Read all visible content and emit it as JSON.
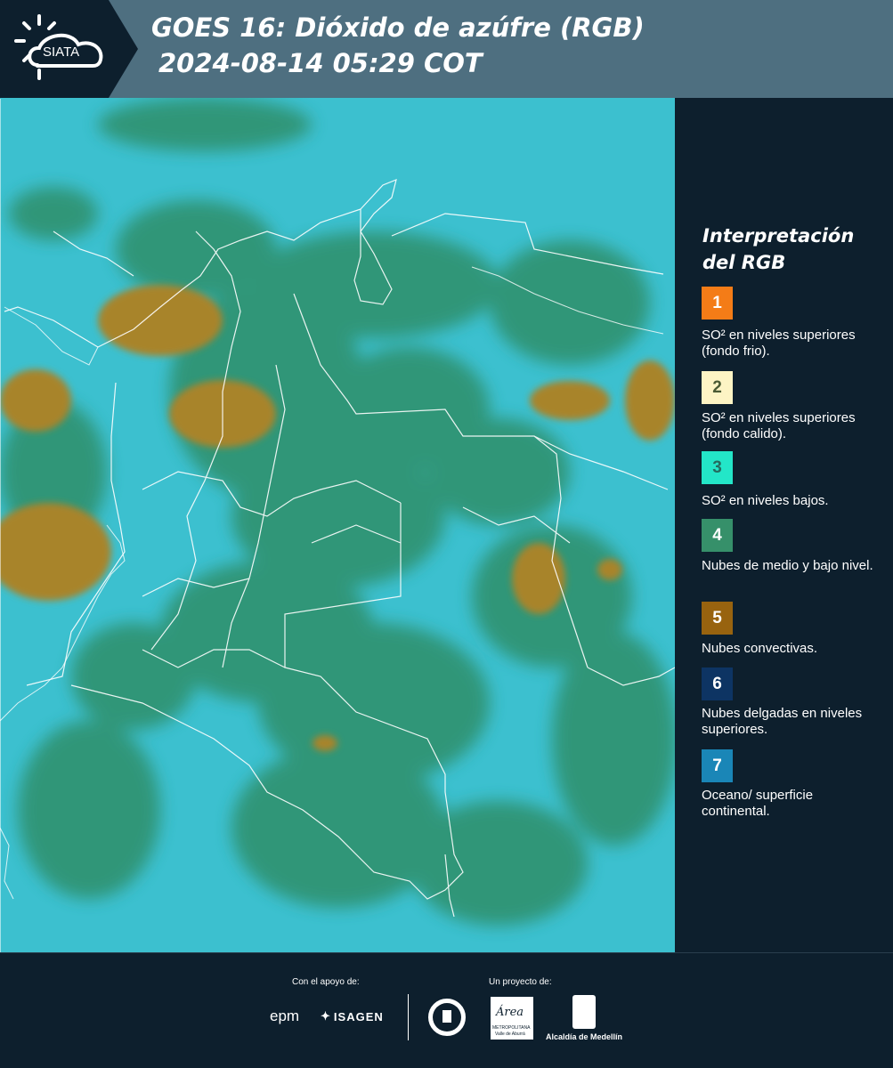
{
  "header": {
    "brand": "SIATA",
    "title_line1": "GOES 16: Dióxido de azúfre (RGB)",
    "title_line2": "2024-08-14 05:29 COT",
    "background_color": "#4e6f80"
  },
  "legend": {
    "title": "Interpretación del RGB",
    "items": [
      {
        "number": "1",
        "color": "#f47c17",
        "text_color": "#ffffff",
        "label": "SO² en niveles superiores (fondo frio)."
      },
      {
        "number": "2",
        "color": "#fdf4c4",
        "text_color": "#4a5a33",
        "label": "SO² en niveles superiores (fondo calido)."
      },
      {
        "number": "3",
        "color": "#23e6c8",
        "text_color": "#256b5f",
        "label": "SO² en niveles bajos."
      },
      {
        "number": "4",
        "color": "#36906a",
        "text_color": "#ffffff",
        "label": "Nubes de medio y bajo nivel."
      },
      {
        "number": "5",
        "color": "#98630f",
        "text_color": "#ffffff",
        "label": "Nubes convectivas."
      },
      {
        "number": "6",
        "color": "#0d3463",
        "text_color": "#ffffff",
        "label": "Nubes delgadas en niveles superiores."
      },
      {
        "number": "7",
        "color": "#1a86b7",
        "text_color": "#ffffff",
        "label": "Oceano/ superficie continental."
      }
    ]
  },
  "footer": {
    "support_label": "Con el apoyo de:",
    "project_label": "Un proyecto de:",
    "sponsor_epm": "epm",
    "sponsor_isagen": "ISAGEN",
    "area_logo": "Área",
    "area_sub1": "METROPOLITANA",
    "area_sub2": "Valle de Aburrá",
    "alcaldia": "Alcaldía de Medellín",
    "medellin_seal": "MEDELLÍN"
  },
  "map": {
    "colors": {
      "background": "#3cc0cf",
      "land_cloud": "#2f8f6a",
      "convective": "#a8842c",
      "border": "#ffffff"
    }
  }
}
